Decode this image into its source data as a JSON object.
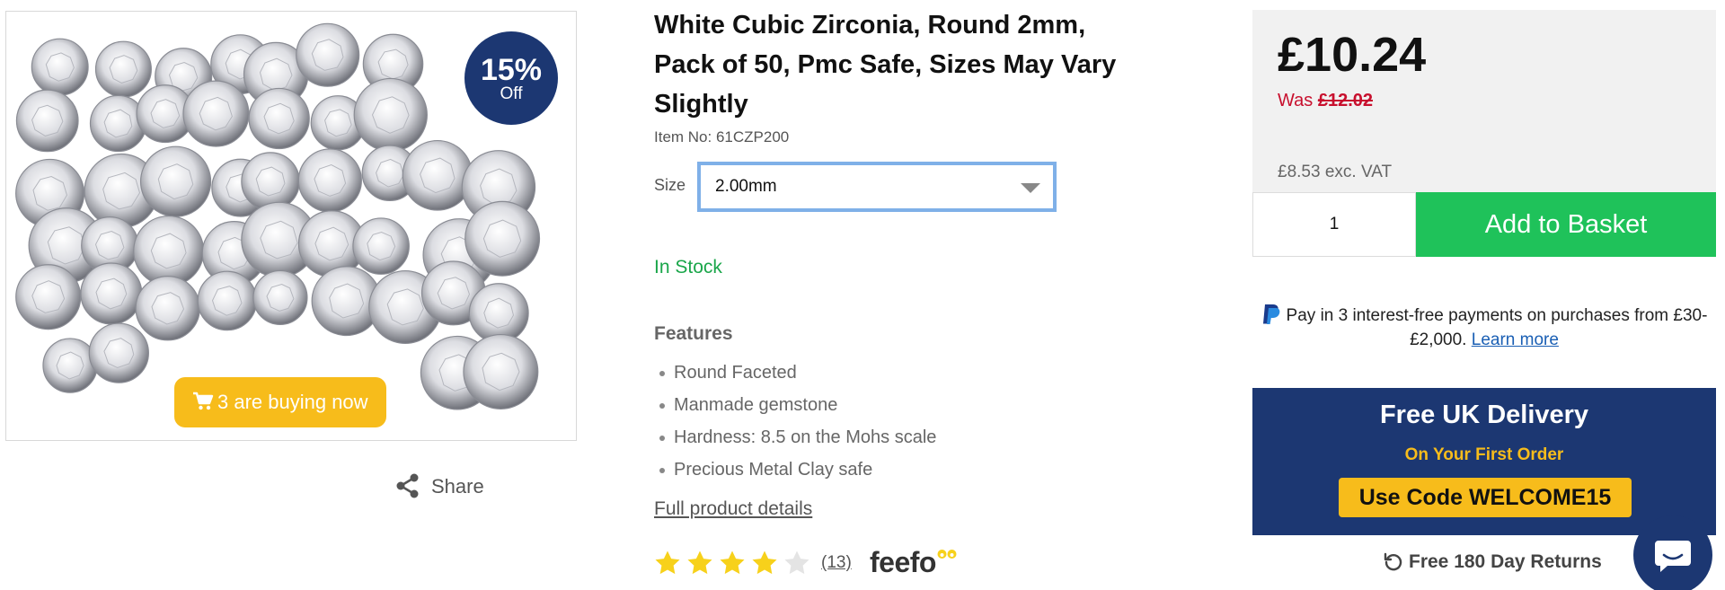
{
  "gallery": {
    "discount_pct": "15%",
    "discount_off": "Off",
    "buying_now": "3 are buying now",
    "share_label": "Share"
  },
  "product": {
    "title": "White Cubic Zirconia, Round 2mm, Pack of 50, Pmc Safe, Sizes May Vary Slightly",
    "item_no": "Item No: 61CZP200",
    "size_label": "Size",
    "size_value": "2.00mm",
    "stock": "In Stock",
    "features_heading": "Features",
    "features": [
      "Round Faceted",
      "Manmade gemstone",
      "Hardness: 8.5 on the Mohs scale",
      "Precious Metal Clay safe"
    ],
    "full_details_link": "Full product details",
    "rating": {
      "stars_filled": 4,
      "stars_total": 5,
      "review_count": "(13)",
      "provider": "feefo"
    }
  },
  "buy": {
    "price": "£10.24",
    "was_label": "Was",
    "was_price": "£12.02",
    "ex_vat": "£8.53 exc. VAT",
    "quantity": "1",
    "add_to_basket": "Add to Basket",
    "paypal_text": "Pay in 3 interest-free payments on purchases from £30-£2,000.",
    "paypal_link": "Learn more"
  },
  "promo": {
    "heading": "Free UK Delivery",
    "subheading": "On Your First Order",
    "code": "Use Code WELCOME15"
  },
  "returns": "Free 180 Day Returns",
  "colors": {
    "navy": "#1c3772",
    "yellow": "#f7bc1b",
    "green": "#1fc25a",
    "stock_green": "#1aa64a",
    "was_red": "#c8102e",
    "select_border": "#7fb0e8"
  },
  "icons": [
    "cart-icon",
    "share-icon",
    "chevron-down-icon",
    "star-icon",
    "paypal-icon",
    "returns-icon",
    "chat-icon"
  ]
}
